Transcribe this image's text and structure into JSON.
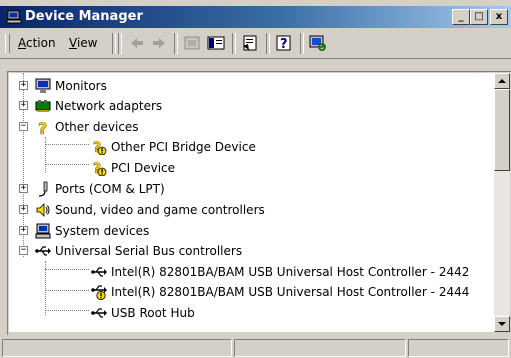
{
  "window": {
    "title": "Device Manager"
  },
  "title_buttons": {
    "minimize": "_",
    "maximize": "□",
    "close": "x"
  },
  "menu": {
    "action": {
      "label": "Action",
      "hotkey": "A",
      "rest": "ction"
    },
    "view": {
      "label": "View",
      "hotkey": "V",
      "rest": "iew"
    }
  },
  "toolbar": {
    "icons": [
      "back-icon",
      "forward-icon",
      "device-view-icon",
      "console-tree-icon",
      "properties-icon",
      "help-icon",
      "scan-hardware-icon"
    ]
  },
  "tree": {
    "monitors": {
      "label": "Monitors",
      "icon": "monitor-icon",
      "expander": "+"
    },
    "network": {
      "label": "Network adapters",
      "icon": "network-adapter-icon",
      "expander": "+"
    },
    "other": {
      "label": "Other devices",
      "icon": "unknown-device-icon",
      "expander": "−"
    },
    "other_pci_bridge": {
      "label": "Other PCI Bridge Device",
      "icon": "warning-device-icon"
    },
    "pci_device": {
      "label": "PCI Device",
      "icon": "warning-device-icon"
    },
    "ports": {
      "label": "Ports (COM & LPT)",
      "icon": "port-icon",
      "expander": "+"
    },
    "sound": {
      "label": "Sound, video and game controllers",
      "icon": "speaker-icon",
      "expander": "+"
    },
    "system": {
      "label": "System devices",
      "icon": "computer-icon",
      "expander": "+"
    },
    "usb": {
      "label": "Universal Serial Bus controllers",
      "icon": "usb-icon",
      "expander": "−"
    },
    "usb_2442": {
      "label": "Intel(R) 82801BA/BAM USB Universal Host Controller - 2442",
      "icon": "usb-icon"
    },
    "usb_2444": {
      "label": "Intel(R) 82801BA/BAM USB Universal Host Controller - 2444",
      "icon": "usb-warning-icon"
    },
    "usb_root_hub": {
      "label": "USB Root Hub",
      "icon": "usb-icon"
    }
  },
  "colors": {
    "titlebar_start": "#0a246a",
    "titlebar_end": "#a6caf0",
    "face": "#d4d0c8",
    "warning": "#ffd800"
  }
}
